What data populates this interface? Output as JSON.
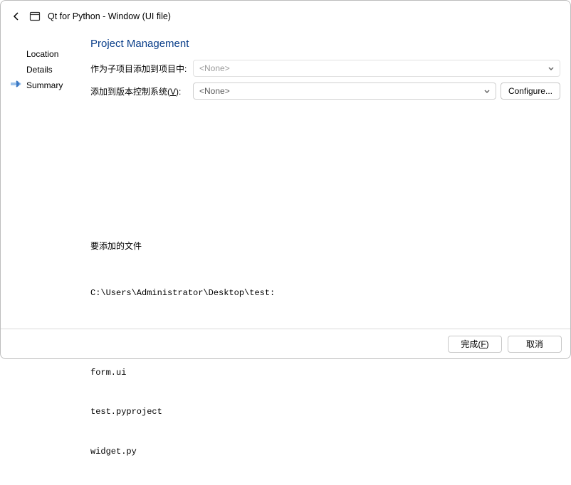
{
  "header": {
    "title": "Qt for Python - Window (UI file)"
  },
  "sidebar": {
    "items": [
      {
        "label": "Location"
      },
      {
        "label": "Details"
      },
      {
        "label": "Summary"
      }
    ]
  },
  "main": {
    "section_title": "Project Management",
    "subproject_label": "作为子项目添加到项目中:",
    "subproject_value": "<None>",
    "vcs_label_prefix": "添加到版本控制系统(",
    "vcs_label_mnemonic": "V",
    "vcs_label_suffix": "):",
    "vcs_value": "<None>",
    "configure_label": "Configure..."
  },
  "files": {
    "heading": "要添加的文件",
    "path": "C:\\Users\\Administrator\\Desktop\\test:",
    "list": [
      "form.ui",
      "test.pyproject",
      "widget.py"
    ]
  },
  "footer": {
    "finish_prefix": "完成(",
    "finish_mnemonic": "F",
    "finish_suffix": ")",
    "cancel": "取消"
  }
}
